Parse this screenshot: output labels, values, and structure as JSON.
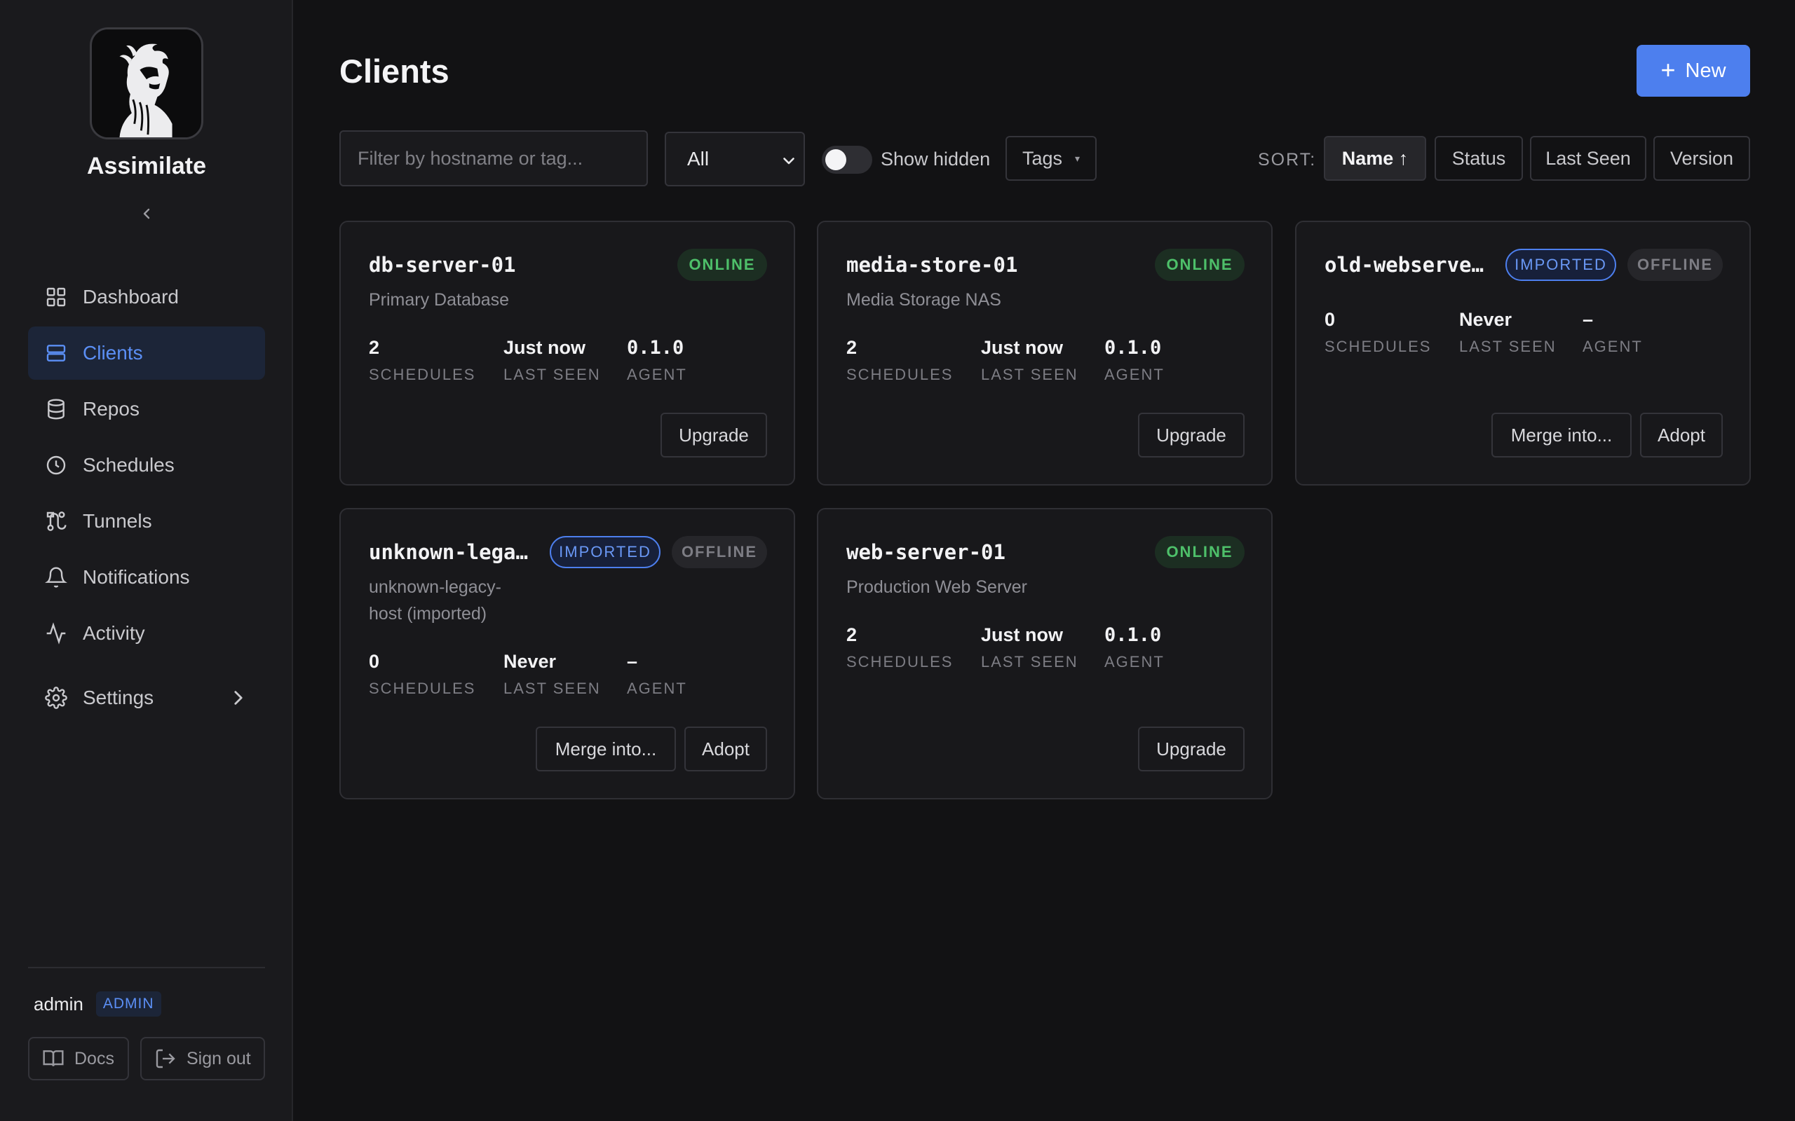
{
  "sidebar": {
    "brand": "Assimilate",
    "nav": [
      {
        "label": "Dashboard",
        "icon": "grid-icon"
      },
      {
        "label": "Clients",
        "icon": "server-icon",
        "active": true
      },
      {
        "label": "Repos",
        "icon": "database-icon"
      },
      {
        "label": "Schedules",
        "icon": "clock-icon"
      },
      {
        "label": "Tunnels",
        "icon": "route-icon"
      },
      {
        "label": "Notifications",
        "icon": "bell-icon"
      },
      {
        "label": "Activity",
        "icon": "activity-icon"
      },
      {
        "label": "Settings",
        "icon": "gear-icon"
      }
    ],
    "user": {
      "name": "admin",
      "role": "ADMIN"
    },
    "docs_label": "Docs",
    "signout_label": "Sign out"
  },
  "header": {
    "title": "Clients",
    "new_label": "New"
  },
  "toolbar": {
    "filter_placeholder": "Filter by hostname or tag...",
    "status_value": "All",
    "show_hidden_label": "Show hidden",
    "show_hidden": false,
    "tags_label": "Tags",
    "sort_label": "SORT:",
    "sort_options": [
      "Name ↑",
      "Status",
      "Last Seen",
      "Version"
    ],
    "sort_active": "Name"
  },
  "labels": {
    "schedules": "SCHEDULES",
    "last_seen": "LAST SEEN",
    "agent": "AGENT"
  },
  "clients": [
    {
      "name": "db-server-01",
      "description": "Primary Database",
      "status": "ONLINE",
      "imported": false,
      "schedules": "2",
      "last_seen": "Just now",
      "agent": "0.1.0",
      "actions": [
        "Upgrade"
      ]
    },
    {
      "name": "media-store-01",
      "description": "Media Storage NAS",
      "status": "ONLINE",
      "imported": false,
      "schedules": "2",
      "last_seen": "Just now",
      "agent": "0.1.0",
      "actions": [
        "Upgrade"
      ]
    },
    {
      "name": "old-webserve…",
      "description": "",
      "status": "OFFLINE",
      "imported": true,
      "imported_label": "IMPORTED",
      "schedules": "0",
      "last_seen": "Never",
      "agent": "–",
      "actions": [
        "Merge into...",
        "Adopt"
      ]
    },
    {
      "name": "unknown-lega…",
      "description_lines": [
        "unknown-legacy-",
        "host (imported)"
      ],
      "status": "OFFLINE",
      "imported": true,
      "imported_label": "IMPORTED",
      "schedules": "0",
      "last_seen": "Never",
      "agent": "–",
      "actions": [
        "Merge into...",
        "Adopt"
      ]
    },
    {
      "name": "web-server-01",
      "description": "Production Web Server",
      "status": "ONLINE",
      "imported": false,
      "schedules": "2",
      "last_seen": "Just now",
      "agent": "0.1.0",
      "actions": [
        "Upgrade"
      ]
    }
  ],
  "colors": {
    "accent": "#4d7fee",
    "online": "#4ec06a",
    "background": "#121214",
    "sidebar": "#1a1a1d"
  }
}
